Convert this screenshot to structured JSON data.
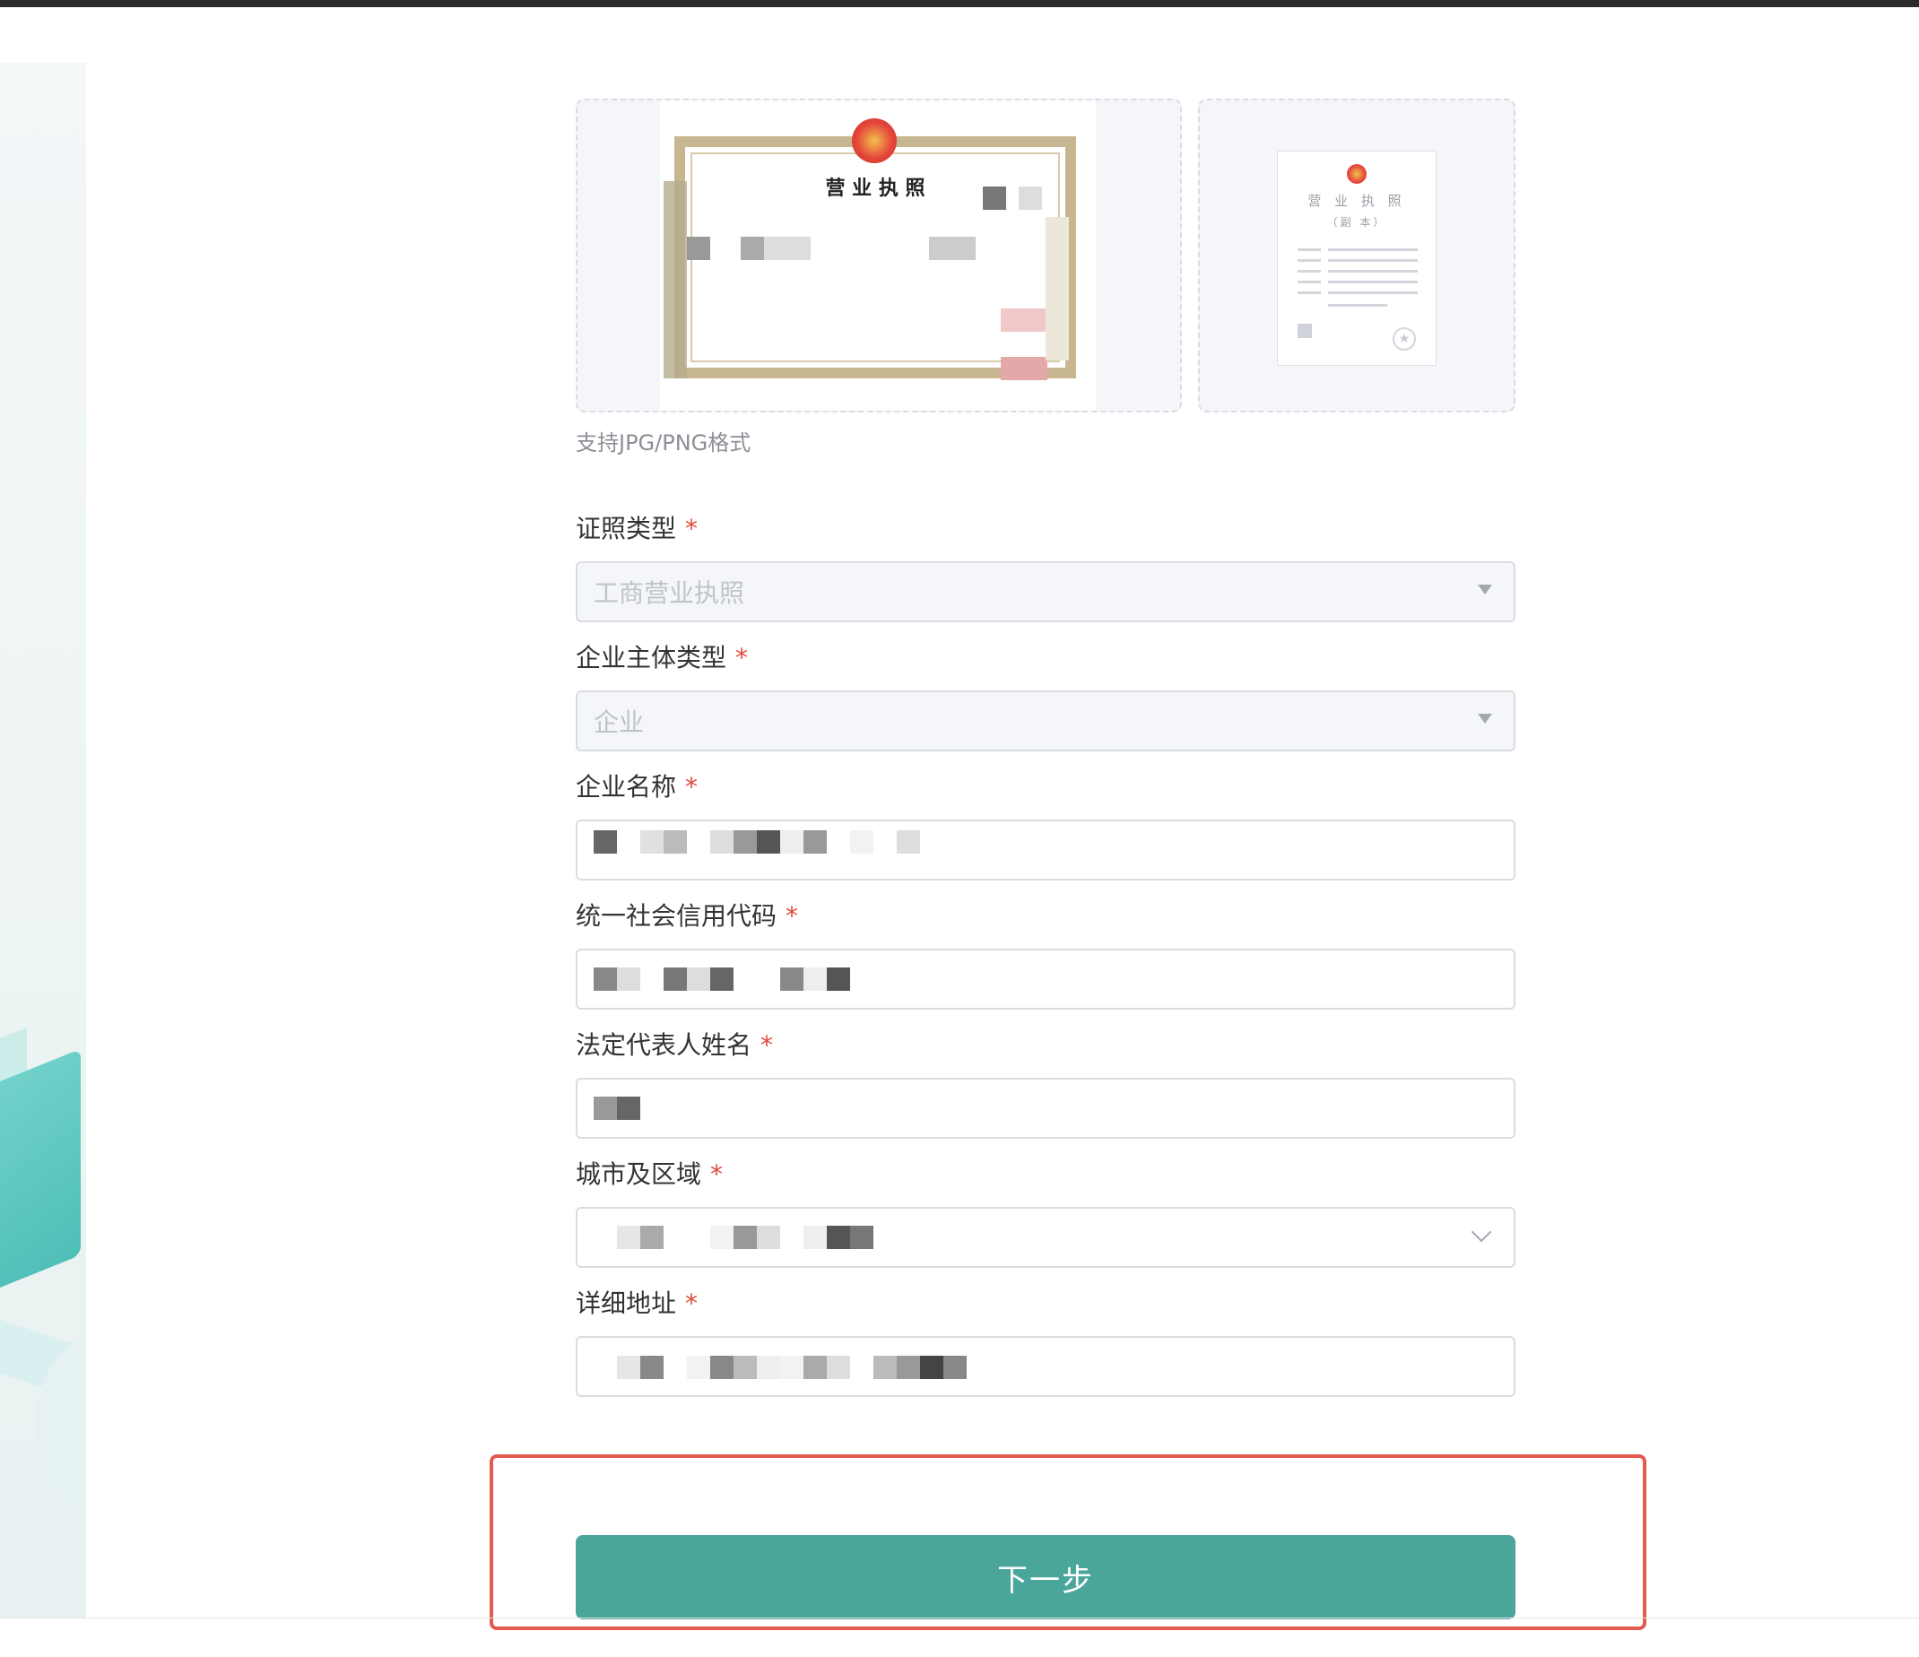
{
  "upload": {
    "hint": "支持JPG/PNG格式",
    "license_front_title": "营 业 执 照",
    "license_copy_title": "营 业 执 照",
    "license_copy_subtitle": "（副 本）"
  },
  "form": {
    "license_type": {
      "label": "证照类型",
      "required_mark": "*",
      "value": "工商营业执照"
    },
    "entity_type": {
      "label": "企业主体类型",
      "required_mark": "*",
      "value": "企业"
    },
    "company_name": {
      "label": "企业名称",
      "required_mark": "*"
    },
    "credit_code": {
      "label": "统一社会信用代码",
      "required_mark": "*"
    },
    "legal_rep": {
      "label": "法定代表人姓名",
      "required_mark": "*"
    },
    "city_region": {
      "label": "城市及区域",
      "required_mark": "*"
    },
    "address": {
      "label": "详细地址",
      "required_mark": "*"
    }
  },
  "actions": {
    "next_label": "下一步"
  },
  "colors": {
    "primary": "#4aa59b",
    "required": "#e0483a",
    "highlight_box": "#e35a4e"
  }
}
